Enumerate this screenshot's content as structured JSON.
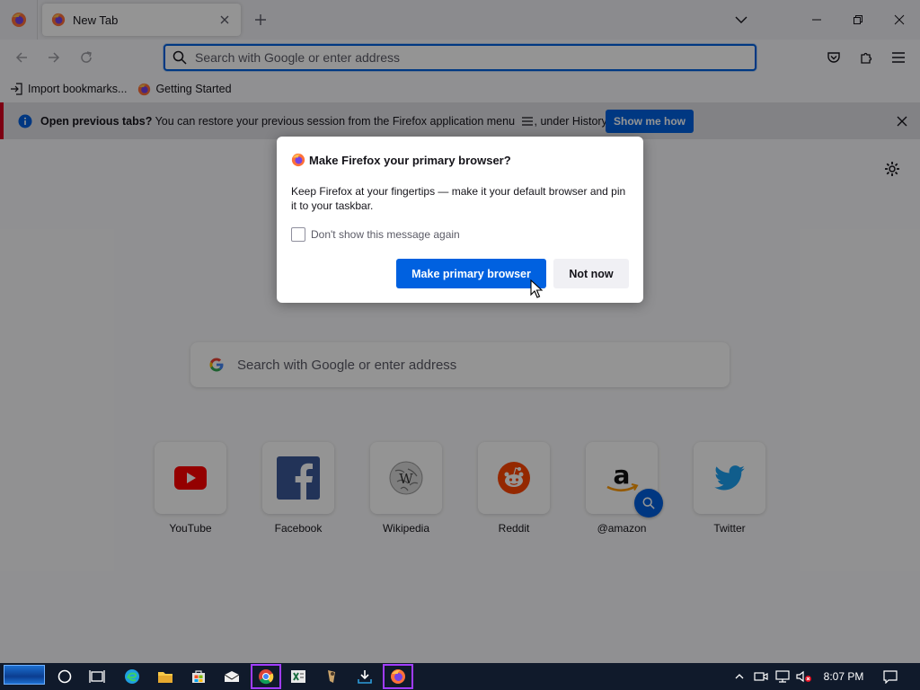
{
  "tab": {
    "title": "New Tab"
  },
  "urlbar": {
    "placeholder": "Search with Google or enter address"
  },
  "bookmarks": [
    {
      "label": "Import bookmarks..."
    },
    {
      "label": "Getting Started"
    }
  ],
  "notification": {
    "title": "Open previous tabs?",
    "message_before": "You can restore your previous session from the Firefox application menu",
    "message_after": ", under History.",
    "button": "Show me how"
  },
  "dialog": {
    "title": "Make Firefox your primary browser?",
    "body": "Keep Firefox at your fingertips — make it your default browser and pin it to your taskbar.",
    "checkbox_label": "Don't show this message again",
    "primary_button": "Make primary browser",
    "secondary_button": "Not now"
  },
  "newtab": {
    "search_placeholder": "Search with Google or enter address",
    "tiles": [
      {
        "label": "YouTube",
        "icon": "youtube-icon"
      },
      {
        "label": "Facebook",
        "icon": "facebook-icon"
      },
      {
        "label": "Wikipedia",
        "icon": "wikipedia-icon"
      },
      {
        "label": "Reddit",
        "icon": "reddit-icon"
      },
      {
        "label": "@amazon",
        "icon": "amazon-icon"
      },
      {
        "label": "Twitter",
        "icon": "twitter-icon"
      }
    ]
  },
  "taskbar": {
    "clock": "8:07 PM"
  },
  "colors": {
    "accent": "#0061e0",
    "notification_stripe": "#d70022",
    "taskbar": "#101a2b",
    "active_highlight": "#a03cff"
  }
}
